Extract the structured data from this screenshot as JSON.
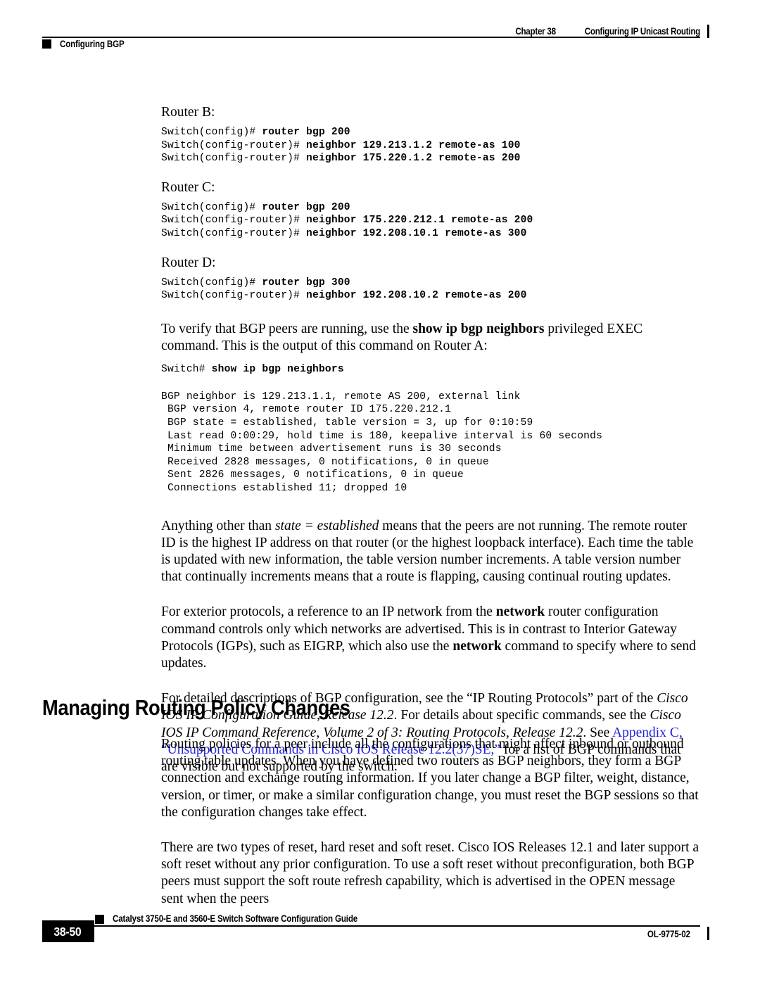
{
  "header": {
    "chapter": "Chapter 38",
    "chapter_title": "Configuring IP Unicast Routing",
    "section": "Configuring BGP"
  },
  "body": {
    "router_b_label": "Router B:",
    "router_b_code": [
      [
        {
          "t": "Switch(config)# ",
          "b": false
        },
        {
          "t": "router bgp ",
          "b": true
        },
        {
          "t": "200",
          "b": true
        }
      ],
      [
        {
          "t": "Switch(config-router)# ",
          "b": false
        },
        {
          "t": "neighbor 129.213.1.2 remote-as ",
          "b": true
        },
        {
          "t": "100",
          "b": true
        }
      ],
      [
        {
          "t": "Switch(config-router)# ",
          "b": false
        },
        {
          "t": "neighbor 175.220.1.2 remote-as ",
          "b": true
        },
        {
          "t": "200",
          "b": true
        }
      ]
    ],
    "router_c_label": "Router C:",
    "router_c_code": [
      [
        {
          "t": "Switch(config)# ",
          "b": false
        },
        {
          "t": "router bgp ",
          "b": true
        },
        {
          "t": "200",
          "b": true
        }
      ],
      [
        {
          "t": "Switch(config-router)# ",
          "b": false
        },
        {
          "t": "neighbor 175.220.212.1 remote-as ",
          "b": true
        },
        {
          "t": "200",
          "b": true
        }
      ],
      [
        {
          "t": "Switch(config-router)# ",
          "b": false
        },
        {
          "t": "neighbor 192.208.10.1 remote-as ",
          "b": true
        },
        {
          "t": "300",
          "b": true
        }
      ]
    ],
    "router_d_label": "Router D:",
    "router_d_code": [
      [
        {
          "t": "Switch(config)# ",
          "b": false
        },
        {
          "t": "router bgp ",
          "b": true
        },
        {
          "t": "300",
          "b": true
        }
      ],
      [
        {
          "t": "Switch(config-router)# ",
          "b": false
        },
        {
          "t": "neighbor 192.208.10.2 remote-as ",
          "b": true
        },
        {
          "t": "200",
          "b": true
        }
      ]
    ],
    "verify_para": [
      {
        "t": "To verify that BGP peers are running, use the ",
        "s": "n"
      },
      {
        "t": "show ip bgp neighbors",
        "s": "b"
      },
      {
        "t": " privileged EXEC command. This is the output of this command on Router A:",
        "s": "n"
      }
    ],
    "show_command": [
      [
        {
          "t": "Switch# ",
          "b": false
        },
        {
          "t": "show ip bgp neighbors",
          "b": true
        }
      ]
    ],
    "show_output": [
      "BGP neighbor is 129.213.1.1, remote AS 200, external link",
      " BGP version 4, remote router ID 175.220.212.1",
      " BGP state = established, table version = 3, up for 0:10:59",
      " Last read 0:00:29, hold time is 180, keepalive interval is 60 seconds",
      " Minimum time between advertisement runs is 30 seconds",
      " Received 2828 messages, 0 notifications, 0 in queue",
      " Sent 2826 messages, 0 notifications, 0 in queue",
      " Connections established 11; dropped 10"
    ],
    "anything_para": [
      {
        "t": "Anything other than ",
        "s": "n"
      },
      {
        "t": "state = established",
        "s": "i"
      },
      {
        "t": " means that the peers are not running. The remote router ID is the highest IP address on that router (or the highest loopback interface). Each time the table is updated with new information, the table version number increments. A table version number that continually increments means that a route is flapping, causing continual routing updates.",
        "s": "n"
      }
    ],
    "exterior_para": [
      {
        "t": "For exterior protocols, a reference to an IP network from the ",
        "s": "n"
      },
      {
        "t": "network",
        "s": "b"
      },
      {
        "t": " router configuration command controls only which networks are advertised. This is in contrast to Interior Gateway Protocols (IGPs), such as EIGRP, which also use the ",
        "s": "n"
      },
      {
        "t": "network",
        "s": "b"
      },
      {
        "t": " command to specify where to send updates.",
        "s": "n"
      }
    ],
    "detailed_para": [
      {
        "t": "For detailed descriptions of BGP configuration, see the “IP Routing Protocols” part of the ",
        "s": "n"
      },
      {
        "t": "Cisco IOS IP Configuration Guide, Release 12.2",
        "s": "i"
      },
      {
        "t": ". For details about specific commands, see the ",
        "s": "n"
      },
      {
        "t": "Cisco IOS IP Command Reference, Volume 2 of 3: Routing Protocols, Release 12.2",
        "s": "i"
      },
      {
        "t": ". See ",
        "s": "n"
      },
      {
        "t": "Appendix C, “Unsupported Commands in Cisco IOS Release 12.2(37)SE,”",
        "s": "link"
      },
      {
        "t": " for a list of BGP commands that are visible but not supported by the switch.",
        "s": "n"
      }
    ]
  },
  "section_heading": "Managing Routing Policy Changes",
  "after_heading": {
    "policies_para": [
      {
        "t": "Routing policies for a peer include all the configurations that might affect inbound or outbound routing table updates. When you have defined two routers as BGP neighbors, they form a BGP connection and exchange routing information. If you later change a BGP filter, weight, distance, version, or timer, or make a similar configuration change, you must reset the BGP sessions so that the configuration changes take effect.",
        "s": "n"
      }
    ],
    "reset_para": [
      {
        "t": "There are two types of reset, hard reset and soft reset. Cisco IOS Releases 12.1 and later support a soft reset without any prior configuration. To use a soft reset without preconfiguration, both BGP peers must support the soft route refresh capability, which is advertised in the OPEN message sent when the peers",
        "s": "n"
      }
    ]
  },
  "footer": {
    "guide_title": "Catalyst 3750-E and 3560-E Switch Software Configuration Guide",
    "page_number": "38-50",
    "doc_id": "OL-9775-02"
  },
  "colors": {
    "link": "#2222dd",
    "text": "#000000",
    "rule": "#000000"
  }
}
